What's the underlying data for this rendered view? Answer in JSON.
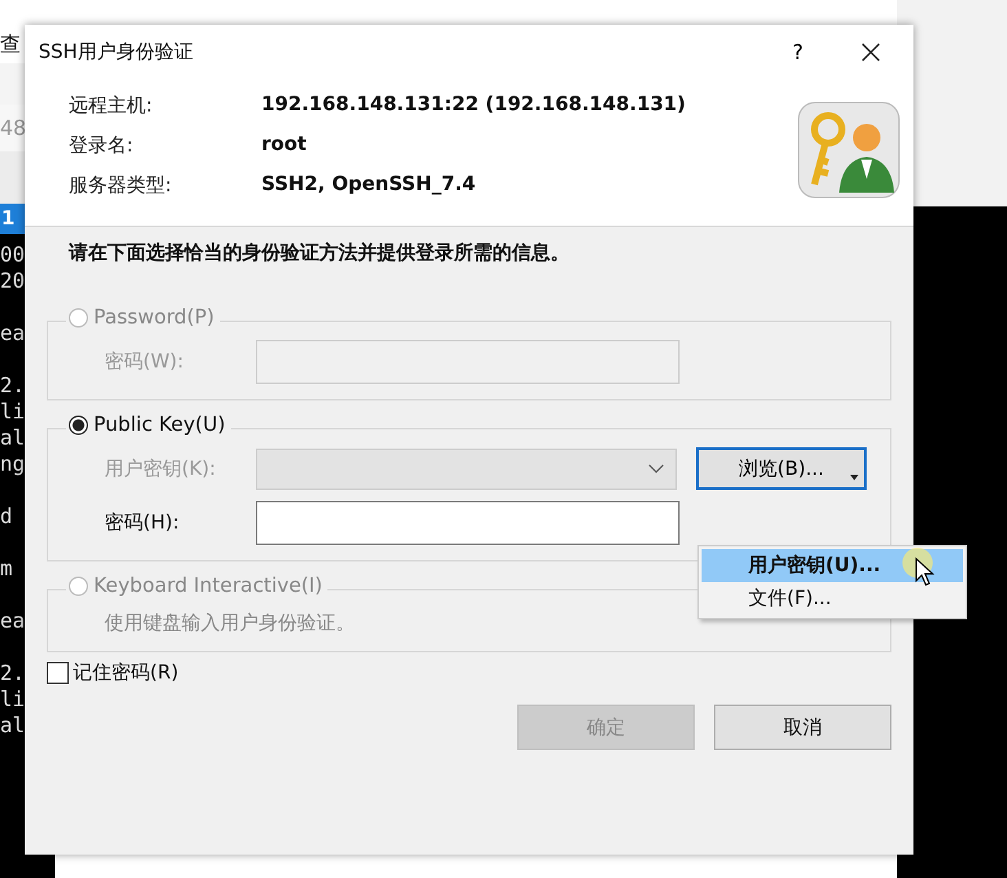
{
  "background": {
    "menu_label": "查",
    "address_fragment": "48",
    "tab_label": "1",
    "terminal_blocks": [
      [
        "00",
        "20"
      ],
      [
        "ea"
      ],
      [
        "2.",
        "li",
        "al",
        "ng"
      ],
      [
        "d"
      ],
      [
        "m"
      ],
      [
        "ea"
      ],
      [
        "2.",
        "li",
        "al"
      ]
    ]
  },
  "dialog": {
    "title": "SSH用户身份验证",
    "help": "?",
    "info": [
      {
        "label": "远程主机:",
        "value": "192.168.148.131:22 (192.168.148.131)"
      },
      {
        "label": "登录名:",
        "value": "root"
      },
      {
        "label": "服务器类型:",
        "value": "SSH2, OpenSSH_7.4"
      }
    ],
    "instruction": "请在下面选择恰当的身份验证方法并提供登录所需的信息。",
    "methods": [
      {
        "kind": "password",
        "label": "Password(P)",
        "selected": false,
        "disabled": true,
        "fields": [
          {
            "kind": "input",
            "label": "密码(W):",
            "disabled": true
          }
        ]
      },
      {
        "kind": "fields",
        "label": "Public Key(U)",
        "selected": true,
        "disabled": false,
        "fields": [
          {
            "kind": "combo",
            "label": "用户密钥(K):",
            "disabled": true,
            "button": "浏览(B)..."
          },
          {
            "kind": "input",
            "label": "密码(H):",
            "disabled": false
          }
        ]
      },
      {
        "kind": "note",
        "label": "Keyboard Interactive(I)",
        "selected": false,
        "disabled": true,
        "note": "使用键盘输入用户身份验证。"
      }
    ],
    "menu": [
      {
        "label": "用户密钥(U)...",
        "selected": true
      },
      {
        "label": "文件(F)...",
        "selected": false
      }
    ],
    "remember": {
      "label": "记住密码(R)",
      "checked": false
    },
    "buttons": [
      {
        "label": "确定",
        "disabled": true
      },
      {
        "label": "取消",
        "disabled": false
      }
    ]
  }
}
